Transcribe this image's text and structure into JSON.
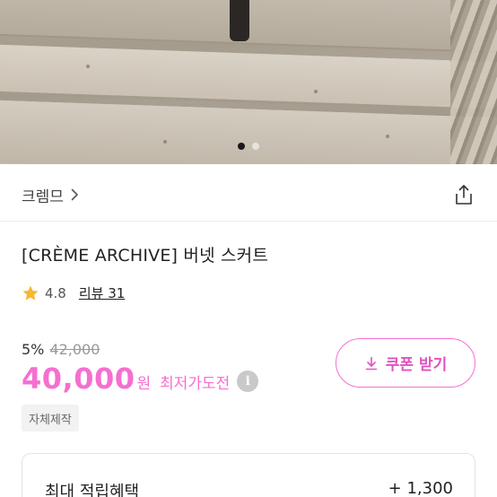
{
  "product_image": {
    "icon": "stairs-photo",
    "carousel_active_index": 1,
    "carousel_count": 2
  },
  "shop": {
    "name": "크렘므",
    "chevron_icon": "chevron-right-icon",
    "share_icon": "share-icon"
  },
  "product": {
    "title": "[CRÈME ARCHIVE] 버넷 스커트",
    "rating": "4.8",
    "review_label": "리뷰 31",
    "discount_rate": "5%",
    "original_price": "42,000",
    "price": "40,000",
    "currency": "원",
    "lowest_label": "최저가도전",
    "info_glyph": "i",
    "tag": "자체제작"
  },
  "coupon": {
    "label": "쿠폰 받기",
    "icon": "download-icon"
  },
  "benefit": {
    "label": "최대 적립혜택",
    "value": "+ 1,300"
  },
  "colors": {
    "accent": "#f56fd0",
    "star": "#f5b82e"
  }
}
